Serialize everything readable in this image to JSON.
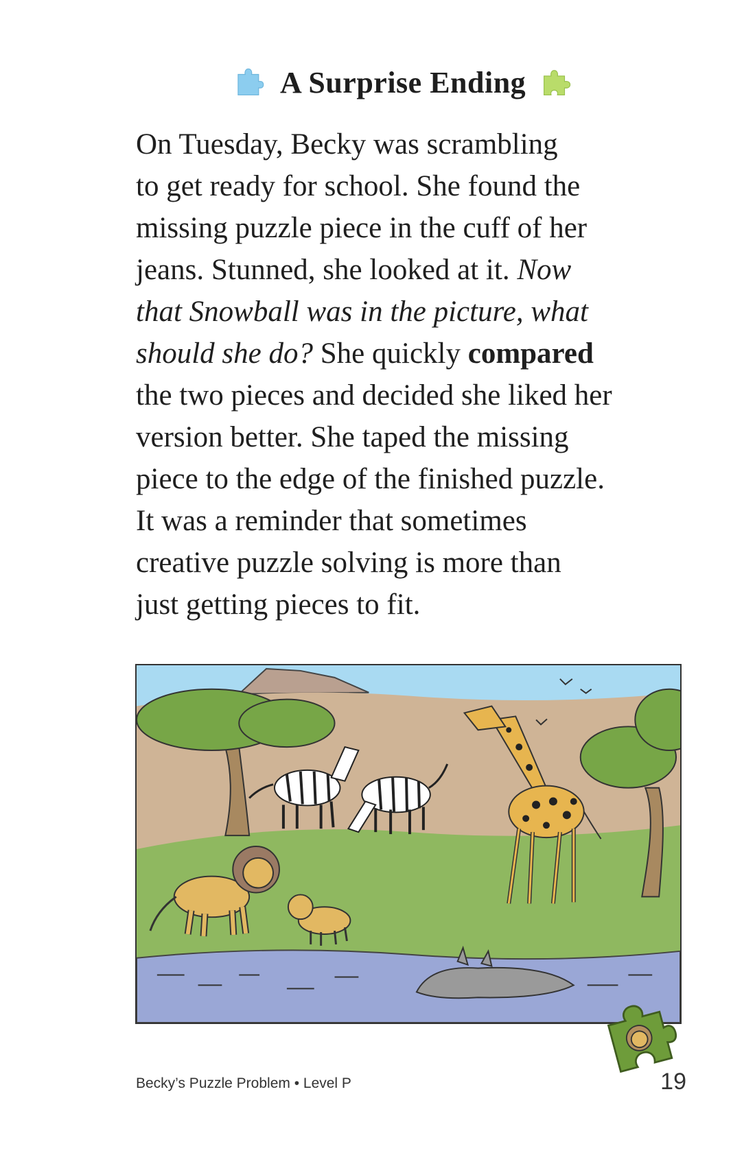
{
  "title": "A Surprise Ending",
  "icons": {
    "left": "puzzle-piece-icon-blue",
    "right": "puzzle-piece-icon-green",
    "corner": "puzzle-piece-lion-icon"
  },
  "colors": {
    "left_piece": "#8ccdef",
    "right_piece": "#b9dc6a",
    "corner_piece": "#6e9c3a"
  },
  "story": {
    "line1": "On Tuesday, Becky was scrambling",
    "line2": "to get ready for school. She found the",
    "line3": "missing puzzle piece in the cuff of her",
    "line4_a": "jeans. Stunned, she looked at it. ",
    "line4_b": "Now",
    "line5": "that Snowball was in the picture, what",
    "line6_a": "should she do?",
    "line6_b": " She quickly ",
    "line6_c": "compared",
    "line7": "the two pieces and decided she liked her",
    "line8": "version better. She taped the missing",
    "line9": "piece to the edge of the finished puzzle.",
    "line10": "It was a reminder that sometimes",
    "line11": "creative puzzle solving is more than",
    "line12": "just getting pieces to fit."
  },
  "footer": {
    "book": "Becky’s Puzzle Problem • Level P",
    "page": "19"
  }
}
